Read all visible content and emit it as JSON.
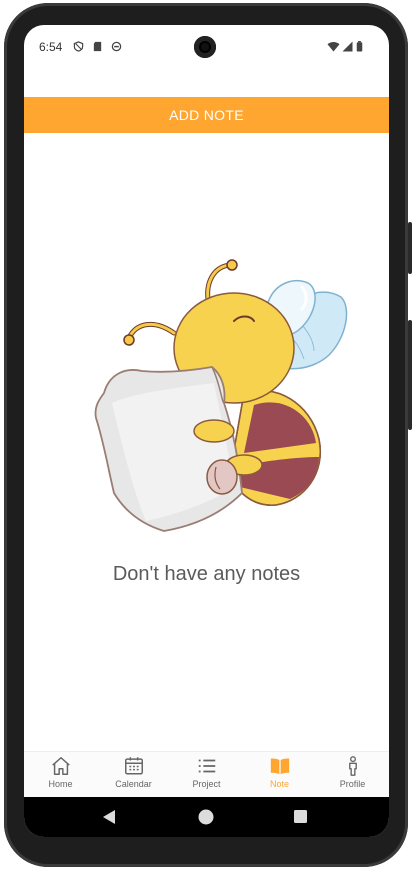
{
  "status_bar": {
    "time": "6:54",
    "left_icons": [
      "shield-icon",
      "sd-card-icon",
      "sync-icon"
    ],
    "right_icons": [
      "wifi-icon",
      "signal-icon",
      "battery-icon"
    ]
  },
  "header": {
    "add_note_label": "ADD NOTE"
  },
  "empty_state": {
    "illustration": "bee-hugging-pillow",
    "message": "Don't have any notes"
  },
  "tabs": [
    {
      "label": "Home",
      "icon": "home-icon",
      "active": false
    },
    {
      "label": "Calendar",
      "icon": "calendar-icon",
      "active": false
    },
    {
      "label": "Project",
      "icon": "list-icon",
      "active": false
    },
    {
      "label": "Note",
      "icon": "book-icon",
      "active": true
    },
    {
      "label": "Profile",
      "icon": "person-icon",
      "active": false
    }
  ],
  "nav_bar": {
    "icons": [
      "back-icon",
      "home-circle-icon",
      "recents-icon"
    ]
  },
  "colors": {
    "accent": "#ffa630",
    "background": "#ffffff",
    "inactive": "#666666"
  }
}
